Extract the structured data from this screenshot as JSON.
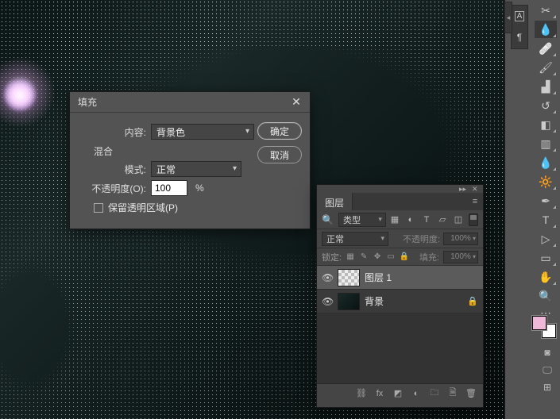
{
  "dialog": {
    "title": "填充",
    "content_label": "内容:",
    "content_value": "背景色",
    "blend_group": "混合",
    "mode_label": "模式:",
    "mode_value": "正常",
    "opacity_label": "不透明度(O):",
    "opacity_value": "100",
    "opacity_unit": "%",
    "preserve_label": "保留透明区域(P)",
    "ok": "确定",
    "cancel": "取消"
  },
  "layers_panel": {
    "tab": "图层",
    "kind_label": "类型",
    "blend_mode": "正常",
    "opacity_label": "不透明度:",
    "opacity_value": "100%",
    "lock_label": "锁定:",
    "fill_label": "填充:",
    "fill_value": "100%",
    "layers": [
      {
        "name": "图层 1",
        "selected": true,
        "thumb": "checker",
        "locked": false
      },
      {
        "name": "背景",
        "selected": false,
        "thumb": "img",
        "locked": true
      }
    ]
  },
  "colors": {
    "foreground": "#f0b8d8",
    "background": "#ffffff"
  }
}
